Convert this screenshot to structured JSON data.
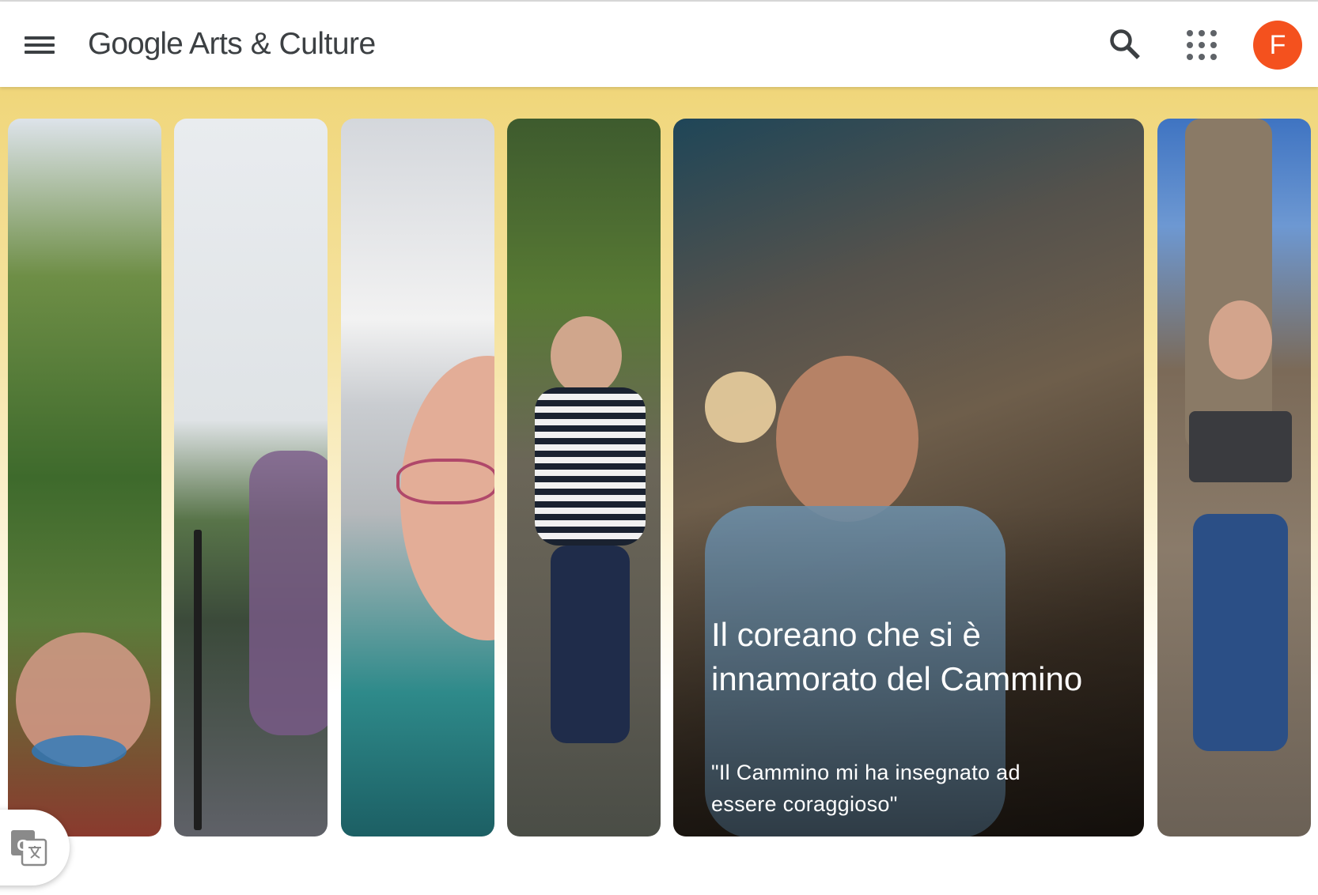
{
  "header": {
    "menu_icon": "hamburger-menu-icon",
    "logo_brand": "Google",
    "logo_product": "Arts & Culture",
    "search_icon": "search-icon",
    "apps_icon": "apps-grid-icon",
    "avatar_letter": "F",
    "avatar_color": "#f4511e"
  },
  "hero": {
    "background_color": "#f0d67a",
    "cards": [
      {
        "image": "hands-with-bracelets-photo"
      },
      {
        "image": "hikers-with-poles-photo"
      },
      {
        "image": "selfie-snowy-mountain-photo"
      },
      {
        "image": "woman-striped-shirt-photo"
      },
      {
        "image": "man-with-chopsticks-photo",
        "title": "Il coreano che si è innamorato del Cammino",
        "quote": "\"Il Cammino mi ha insegnato ad essere coraggioso\""
      },
      {
        "image": "man-with-laptop-photo"
      }
    ]
  },
  "translate_icon": "google-translate-icon"
}
